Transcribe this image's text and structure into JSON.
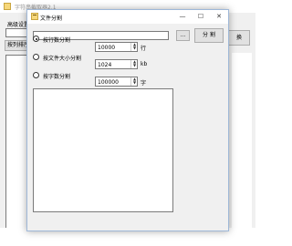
{
  "background_window": {
    "title": "字符串截取器2.1",
    "settings_label": "高级设置",
    "sort_button_label": "按列排序",
    "right_button_label": "换"
  },
  "dialog": {
    "title": "文件分割",
    "browse_label": "...",
    "split_button_label": "分 割",
    "options": [
      {
        "label": "按行数分割",
        "value": "10000",
        "unit": "行",
        "selected": true
      },
      {
        "label": "按文件大小分割",
        "value": "1024",
        "unit": "kb",
        "selected": false
      },
      {
        "label": "按字数分割",
        "value": "100000",
        "unit": "字",
        "selected": false
      }
    ],
    "window_buttons": {
      "minimize": "—",
      "maximize": "☐",
      "close": "✕"
    }
  },
  "icons": {
    "spin_up": "▲",
    "spin_down": "▼"
  },
  "colors": {
    "dialog_border": "#9fb8d8",
    "window_bg": "#f0f0f0",
    "button_bg": "#e1e1e1"
  }
}
